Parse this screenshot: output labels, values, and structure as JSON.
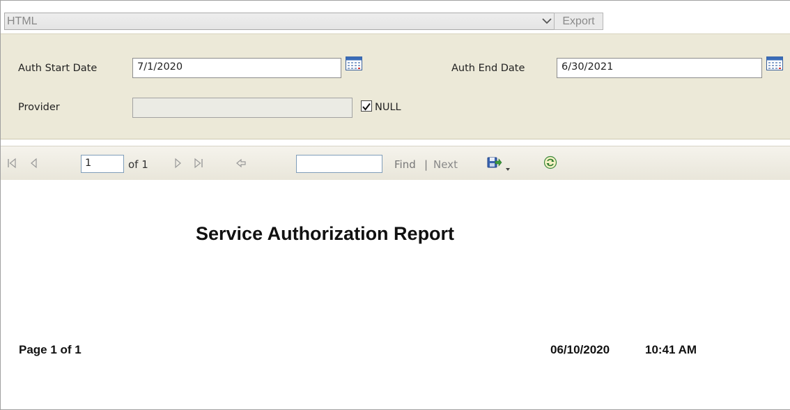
{
  "export_bar": {
    "format_value": "HTML",
    "export_label": "Export"
  },
  "params": {
    "start_label": "Auth Start Date",
    "start_value": "7/1/2020",
    "end_label": "Auth End Date",
    "end_value": "6/30/2021",
    "provider_label": "Provider",
    "provider_value": "",
    "null_label": "NULL",
    "null_checked": true
  },
  "toolbar": {
    "page_value": "1",
    "page_of": "of 1",
    "find_value": "",
    "find_label": "Find",
    "separator": "|",
    "next_label": "Next"
  },
  "report": {
    "title": "Service Authorization Report",
    "page_text": "Page 1 of 1",
    "date": "06/10/2020",
    "time": "10:41 AM"
  },
  "icons": {
    "first_page": "first-page-icon",
    "prev_page": "previous-page-icon",
    "next_page": "next-page-icon",
    "last_page": "last-page-icon",
    "back": "back-to-parent-icon",
    "export": "export-save-icon",
    "refresh": "refresh-icon",
    "calendar": "calendar-icon"
  }
}
